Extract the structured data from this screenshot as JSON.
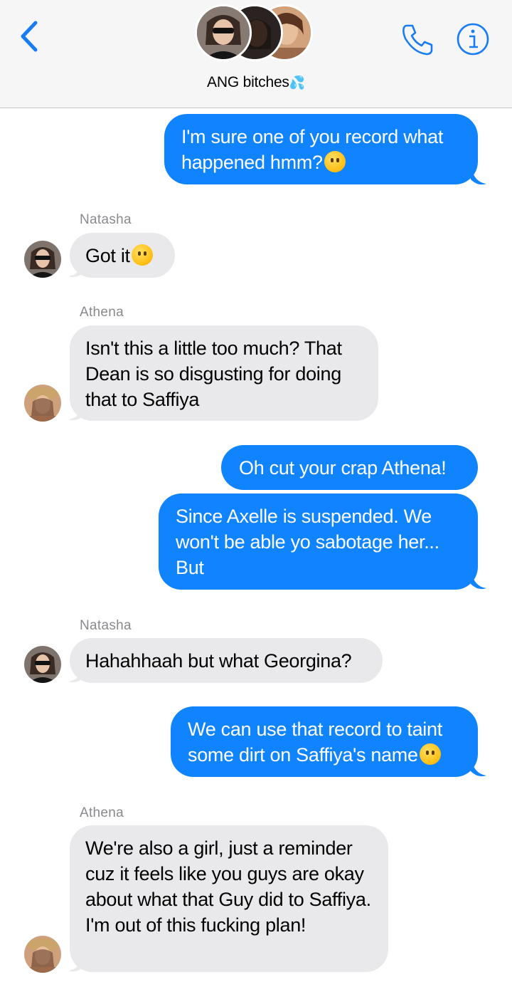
{
  "header": {
    "group_name": "ANG bitches",
    "group_emoji": "💦",
    "back_icon": "chevron-left-icon",
    "call_icon": "phone-icon",
    "info_icon": "info-icon"
  },
  "messages": [
    {
      "sender": "me",
      "text": "I'm sure one of you record what happened hmm?",
      "emoji": "🤭"
    },
    {
      "sender": "Natasha",
      "text": "Got it",
      "emoji": "🤣"
    },
    {
      "sender": "Athena",
      "text": "Isn't this a little too much? That Dean is so disgusting for doing that to Saffiya"
    },
    {
      "sender": "me",
      "text": "Oh cut your crap Athena!"
    },
    {
      "sender": "me",
      "text": "Since Axelle is suspended. We won't be able yo sabotage her... But"
    },
    {
      "sender": "Natasha",
      "text": "Hahahhaah but what Georgina?"
    },
    {
      "sender": "me",
      "text": "We can use that record to taint some dirt on Saffiya's name",
      "emoji": "🥱"
    },
    {
      "sender": "Athena",
      "text": "We're also a girl, just a reminder cuz it feels like you guys are okay about what that Guy did to Saffiya. I'm out of this fucking plan!"
    }
  ],
  "colors": {
    "sent_bubble": "#1083fe",
    "received_bubble": "#e9e9eb",
    "accent": "#1a7cf5"
  }
}
